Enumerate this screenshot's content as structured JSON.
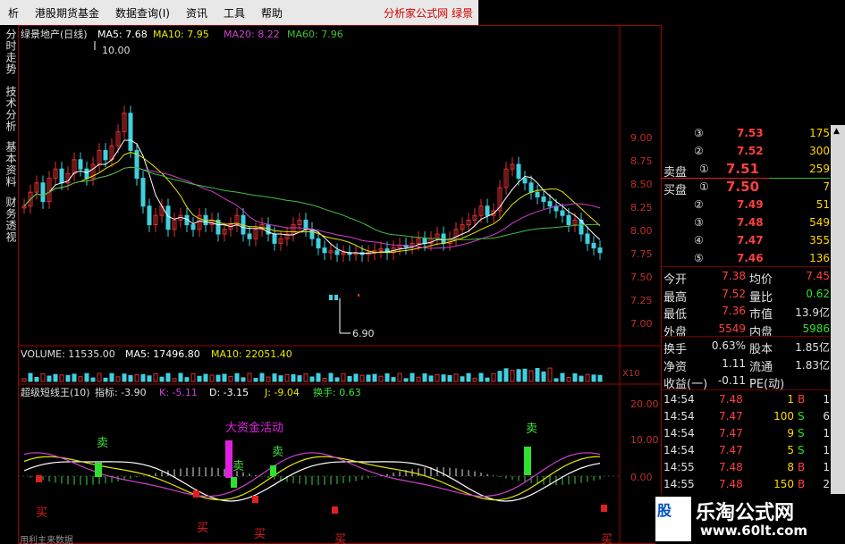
{
  "menu": {
    "items": [
      "析",
      "港股期货基金",
      "数据查询(I)",
      "资讯",
      "工具",
      "帮助"
    ],
    "right_text": "分析家公式网  绿景"
  },
  "side_tabs": [
    "分时走势",
    "技术分析",
    "基本资料",
    "财务透视"
  ],
  "main_header": {
    "title": "绿景地产(日线)",
    "ma5": "MA5: 7.68",
    "ma10": "MA10: 7.95",
    "ma20": "MA20: 8.22",
    "ma60": "MA60: 7.96"
  },
  "price_axis": [
    "9.00",
    "8.75",
    "8.50",
    "8.25",
    "8.00",
    "7.75",
    "7.50",
    "7.25",
    "7.00"
  ],
  "annotations": {
    "high": "10.00",
    "low": "6.90"
  },
  "volume_header": {
    "volume": "VOLUME: 11535.00",
    "ma5": "MA5: 17496.80",
    "ma10": "MA10: 22051.40",
    "scale": "X10"
  },
  "indicator_header": {
    "name": "超级短线王(10)",
    "zhibiao": "指标: -3.90",
    "k": "K: -5.11",
    "d": "D: -3.15",
    "j": "J: -9.04",
    "huanshou": "换手: 0.63"
  },
  "indicator_axis": [
    "20.00",
    "10.00",
    "0.00"
  ],
  "indicator_labels": {
    "big_money": "大资金活动",
    "sell": "卖",
    "buy": "买",
    "bottom_text": "用利主来数据"
  },
  "order_book": [
    {
      "level": "③",
      "price": "7.53",
      "vol": "175",
      "label": ""
    },
    {
      "level": "②",
      "price": "7.52",
      "vol": "300",
      "label": ""
    },
    {
      "level": "①",
      "price": "7.51",
      "vol": "259",
      "label": "卖盘"
    },
    {
      "level": "①",
      "price": "7.50",
      "vol": "7",
      "label": "买盘"
    },
    {
      "level": "②",
      "price": "7.49",
      "vol": "51",
      "label": ""
    },
    {
      "level": "③",
      "price": "7.48",
      "vol": "549",
      "label": ""
    },
    {
      "level": "④",
      "price": "7.47",
      "vol": "355",
      "label": ""
    },
    {
      "level": "⑤",
      "price": "7.46",
      "vol": "136",
      "label": ""
    }
  ],
  "stats": [
    {
      "l1": "今开",
      "v1": "7.38",
      "l2": "均价",
      "v2": "7.45"
    },
    {
      "l1": "最高",
      "v1": "7.52",
      "l2": "量比",
      "v2": "0.62"
    },
    {
      "l1": "最低",
      "v1": "7.36",
      "l2": "市值",
      "v2": "13.9亿"
    },
    {
      "l1": "外盘",
      "v1": "5549",
      "l2": "内盘",
      "v2": "5986"
    },
    {
      "l1": "换手",
      "v1": "0.63%",
      "l2": "股本",
      "v2": "1.85亿"
    },
    {
      "l1": "净资",
      "v1": "1.11",
      "l2": "流通",
      "v2": "1.83亿"
    },
    {
      "l1": "收益(一)",
      "v1": "-0.11",
      "l2": "PE(动)",
      "v2": ""
    }
  ],
  "ticks": [
    {
      "time": "14:54",
      "price": "7.48",
      "vol": "1",
      "side": "B",
      "n": "1"
    },
    {
      "time": "14:54",
      "price": "7.47",
      "vol": "100",
      "side": "S",
      "n": "6"
    },
    {
      "time": "14:54",
      "price": "7.47",
      "vol": "9",
      "side": "S",
      "n": "1"
    },
    {
      "time": "14:54",
      "price": "7.47",
      "vol": "5",
      "side": "S",
      "n": "1"
    },
    {
      "time": "14:55",
      "price": "7.48",
      "vol": "8",
      "side": "B",
      "n": "1"
    },
    {
      "time": "14:55",
      "price": "7.48",
      "vol": "150",
      "side": "B",
      "n": "2"
    }
  ],
  "watermark": {
    "logo": "股",
    "brand": "乐淘公式网",
    "url": "www.60lt.com"
  },
  "colors": {
    "up": "#e03030",
    "down": "#40d0e0",
    "ma5": "#ffffff",
    "ma10": "#e8e800",
    "ma20": "#d040d0",
    "ma60": "#40c040",
    "frame": "#a00000",
    "sell_bar": "#30e030",
    "big_money": "#e020e0",
    "buy_marker": "#e02020"
  }
}
